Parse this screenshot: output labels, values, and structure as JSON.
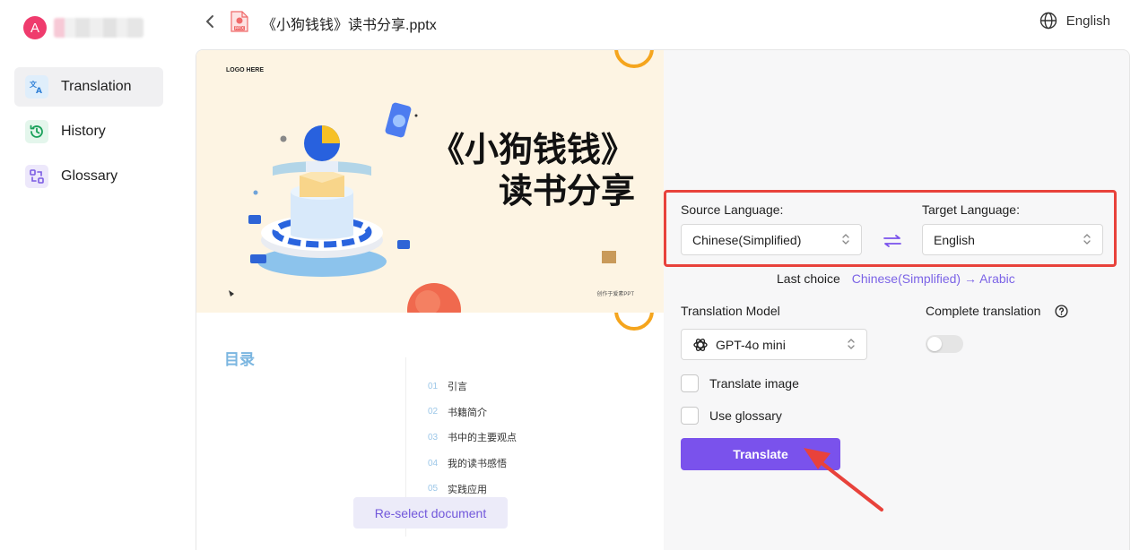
{
  "user": {
    "avatar_letter": "A"
  },
  "sidebar": {
    "items": [
      {
        "label": "Translation",
        "icon": "translate-icon",
        "active": true
      },
      {
        "label": "History",
        "icon": "history-icon",
        "active": false
      },
      {
        "label": "Glossary",
        "icon": "glossary-icon",
        "active": false
      }
    ]
  },
  "header": {
    "file_name": "《小狗钱钱》读书分享.pptx",
    "file_type_badge": "PPTX",
    "ui_language": "English"
  },
  "preview": {
    "slide1": {
      "logo_text": "LOGO HERE",
      "title_line1": "《小狗钱钱》",
      "title_line2": "读书分享",
      "footer_text": "创作于爱素PPT"
    },
    "slide2": {
      "heading": "目录",
      "items": [
        {
          "num": "01",
          "text": "引言"
        },
        {
          "num": "02",
          "text": "书籍简介"
        },
        {
          "num": "03",
          "text": "书中的主要观点"
        },
        {
          "num": "04",
          "text": "我的读书感悟"
        },
        {
          "num": "05",
          "text": "实践应用"
        }
      ]
    },
    "reselect_label": "Re-select document"
  },
  "settings": {
    "source_label": "Source Language:",
    "source_value": "Chinese(Simplified)",
    "target_label": "Target Language:",
    "target_value": "English",
    "last_choice_label": "Last choice",
    "last_choice_value": "Chinese(Simplified) → Arabic",
    "model_label": "Translation Model",
    "model_value": "GPT-4o mini",
    "complete_label": "Complete translation",
    "complete_enabled": false,
    "translate_image_label": "Translate image",
    "translate_image_checked": false,
    "use_glossary_label": "Use glossary",
    "use_glossary_checked": false,
    "translate_button": "Translate"
  },
  "colors": {
    "accent": "#7a52ec",
    "avatar": "#ef3b6d",
    "highlight_box": "#e8423b",
    "link": "#7b63e6"
  }
}
